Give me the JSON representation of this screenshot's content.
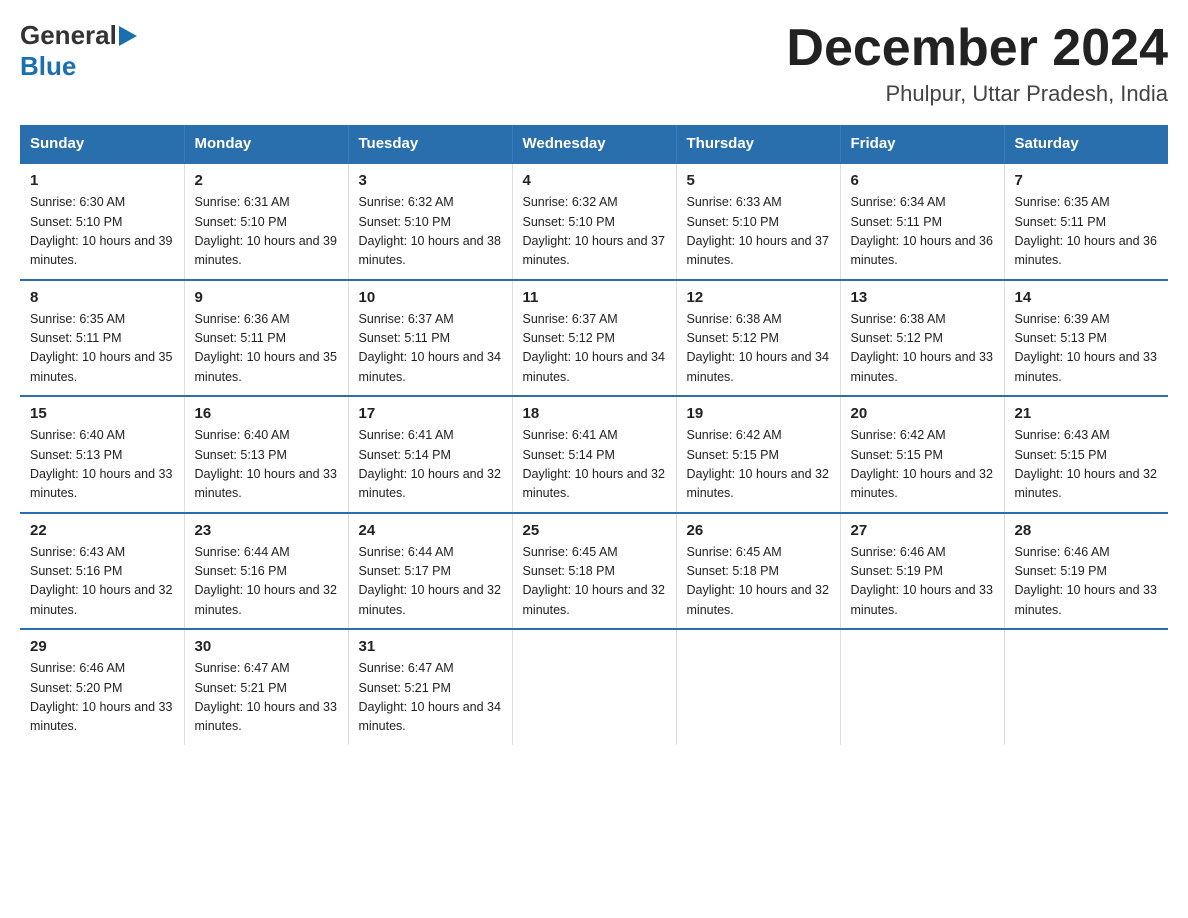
{
  "logo": {
    "text1": "General",
    "text2": "Blue"
  },
  "title": "December 2024",
  "subtitle": "Phulpur, Uttar Pradesh, India",
  "days_header": [
    "Sunday",
    "Monday",
    "Tuesday",
    "Wednesday",
    "Thursday",
    "Friday",
    "Saturday"
  ],
  "weeks": [
    [
      {
        "day": "1",
        "sunrise": "6:30 AM",
        "sunset": "5:10 PM",
        "daylight": "10 hours and 39 minutes."
      },
      {
        "day": "2",
        "sunrise": "6:31 AM",
        "sunset": "5:10 PM",
        "daylight": "10 hours and 39 minutes."
      },
      {
        "day": "3",
        "sunrise": "6:32 AM",
        "sunset": "5:10 PM",
        "daylight": "10 hours and 38 minutes."
      },
      {
        "day": "4",
        "sunrise": "6:32 AM",
        "sunset": "5:10 PM",
        "daylight": "10 hours and 37 minutes."
      },
      {
        "day": "5",
        "sunrise": "6:33 AM",
        "sunset": "5:10 PM",
        "daylight": "10 hours and 37 minutes."
      },
      {
        "day": "6",
        "sunrise": "6:34 AM",
        "sunset": "5:11 PM",
        "daylight": "10 hours and 36 minutes."
      },
      {
        "day": "7",
        "sunrise": "6:35 AM",
        "sunset": "5:11 PM",
        "daylight": "10 hours and 36 minutes."
      }
    ],
    [
      {
        "day": "8",
        "sunrise": "6:35 AM",
        "sunset": "5:11 PM",
        "daylight": "10 hours and 35 minutes."
      },
      {
        "day": "9",
        "sunrise": "6:36 AM",
        "sunset": "5:11 PM",
        "daylight": "10 hours and 35 minutes."
      },
      {
        "day": "10",
        "sunrise": "6:37 AM",
        "sunset": "5:11 PM",
        "daylight": "10 hours and 34 minutes."
      },
      {
        "day": "11",
        "sunrise": "6:37 AM",
        "sunset": "5:12 PM",
        "daylight": "10 hours and 34 minutes."
      },
      {
        "day": "12",
        "sunrise": "6:38 AM",
        "sunset": "5:12 PM",
        "daylight": "10 hours and 34 minutes."
      },
      {
        "day": "13",
        "sunrise": "6:38 AM",
        "sunset": "5:12 PM",
        "daylight": "10 hours and 33 minutes."
      },
      {
        "day": "14",
        "sunrise": "6:39 AM",
        "sunset": "5:13 PM",
        "daylight": "10 hours and 33 minutes."
      }
    ],
    [
      {
        "day": "15",
        "sunrise": "6:40 AM",
        "sunset": "5:13 PM",
        "daylight": "10 hours and 33 minutes."
      },
      {
        "day": "16",
        "sunrise": "6:40 AM",
        "sunset": "5:13 PM",
        "daylight": "10 hours and 33 minutes."
      },
      {
        "day": "17",
        "sunrise": "6:41 AM",
        "sunset": "5:14 PM",
        "daylight": "10 hours and 32 minutes."
      },
      {
        "day": "18",
        "sunrise": "6:41 AM",
        "sunset": "5:14 PM",
        "daylight": "10 hours and 32 minutes."
      },
      {
        "day": "19",
        "sunrise": "6:42 AM",
        "sunset": "5:15 PM",
        "daylight": "10 hours and 32 minutes."
      },
      {
        "day": "20",
        "sunrise": "6:42 AM",
        "sunset": "5:15 PM",
        "daylight": "10 hours and 32 minutes."
      },
      {
        "day": "21",
        "sunrise": "6:43 AM",
        "sunset": "5:15 PM",
        "daylight": "10 hours and 32 minutes."
      }
    ],
    [
      {
        "day": "22",
        "sunrise": "6:43 AM",
        "sunset": "5:16 PM",
        "daylight": "10 hours and 32 minutes."
      },
      {
        "day": "23",
        "sunrise": "6:44 AM",
        "sunset": "5:16 PM",
        "daylight": "10 hours and 32 minutes."
      },
      {
        "day": "24",
        "sunrise": "6:44 AM",
        "sunset": "5:17 PM",
        "daylight": "10 hours and 32 minutes."
      },
      {
        "day": "25",
        "sunrise": "6:45 AM",
        "sunset": "5:18 PM",
        "daylight": "10 hours and 32 minutes."
      },
      {
        "day": "26",
        "sunrise": "6:45 AM",
        "sunset": "5:18 PM",
        "daylight": "10 hours and 32 minutes."
      },
      {
        "day": "27",
        "sunrise": "6:46 AM",
        "sunset": "5:19 PM",
        "daylight": "10 hours and 33 minutes."
      },
      {
        "day": "28",
        "sunrise": "6:46 AM",
        "sunset": "5:19 PM",
        "daylight": "10 hours and 33 minutes."
      }
    ],
    [
      {
        "day": "29",
        "sunrise": "6:46 AM",
        "sunset": "5:20 PM",
        "daylight": "10 hours and 33 minutes."
      },
      {
        "day": "30",
        "sunrise": "6:47 AM",
        "sunset": "5:21 PM",
        "daylight": "10 hours and 33 minutes."
      },
      {
        "day": "31",
        "sunrise": "6:47 AM",
        "sunset": "5:21 PM",
        "daylight": "10 hours and 34 minutes."
      },
      null,
      null,
      null,
      null
    ]
  ]
}
